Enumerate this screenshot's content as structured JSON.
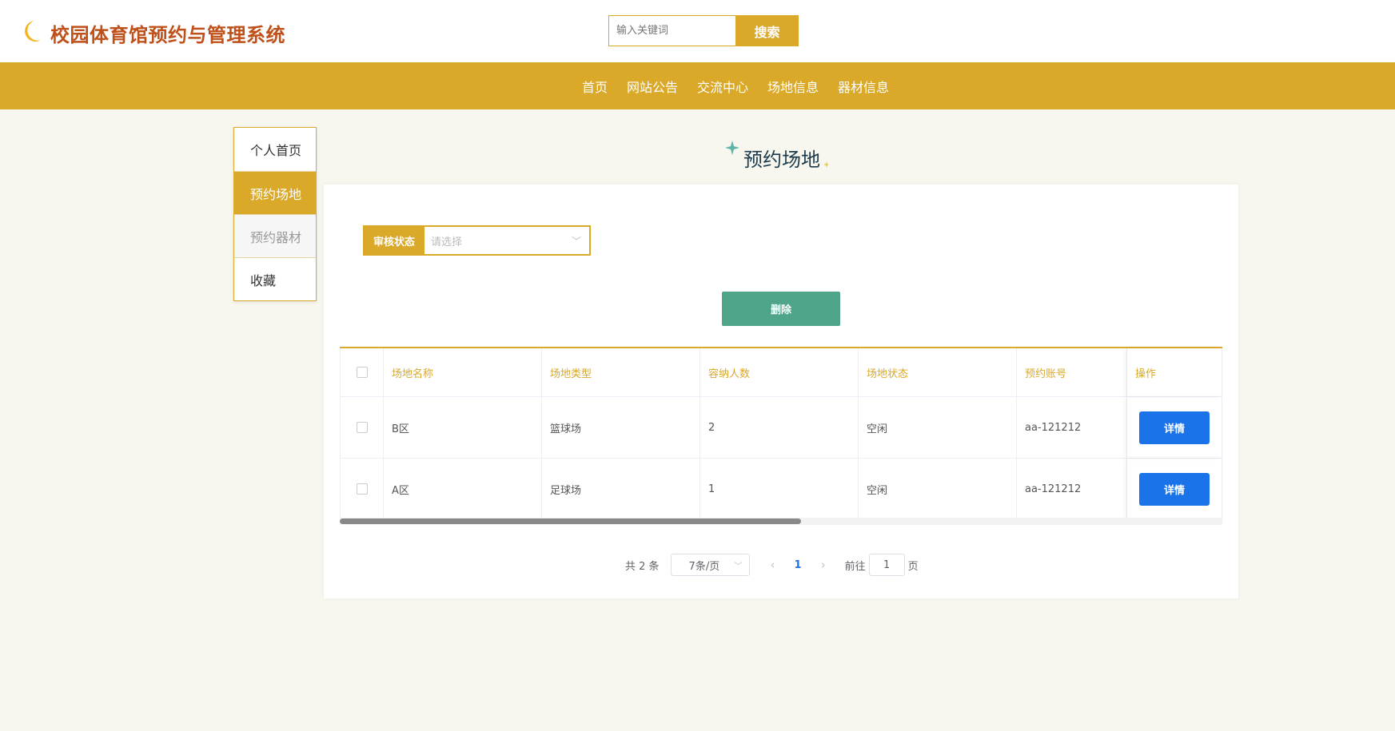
{
  "header": {
    "title": "校园体育馆预约与管理系统",
    "search_placeholder": "输入关键词",
    "search_button": "搜索"
  },
  "nav": [
    "首页",
    "网站公告",
    "交流中心",
    "场地信息",
    "器材信息"
  ],
  "sidebar": [
    "个人首页",
    "预约场地",
    "预约器材",
    "收藏"
  ],
  "page_title": "预约场地",
  "filter": {
    "label": "审核状态",
    "placeholder": "请选择"
  },
  "delete_label": "删除",
  "table": {
    "headers": [
      "场地名称",
      "场地类型",
      "容纳人数",
      "场地状态",
      "预约账号",
      "操作"
    ],
    "rows": [
      {
        "name": "B区",
        "type": "篮球场",
        "capacity": "2",
        "status": "空闲",
        "account": "aa-121212",
        "action": "详情"
      },
      {
        "name": "A区",
        "type": "足球场",
        "capacity": "1",
        "status": "空闲",
        "account": "aa-121212",
        "action": "详情"
      }
    ]
  },
  "pagination": {
    "total": "共 2 条",
    "page_size": "7条/页",
    "current": "1",
    "goto_label": "前往",
    "goto_value": "1",
    "page_suffix": "页"
  },
  "colors": {
    "accent": "#daa92a",
    "delete": "#4ea58a",
    "detail": "#1a73e8"
  }
}
